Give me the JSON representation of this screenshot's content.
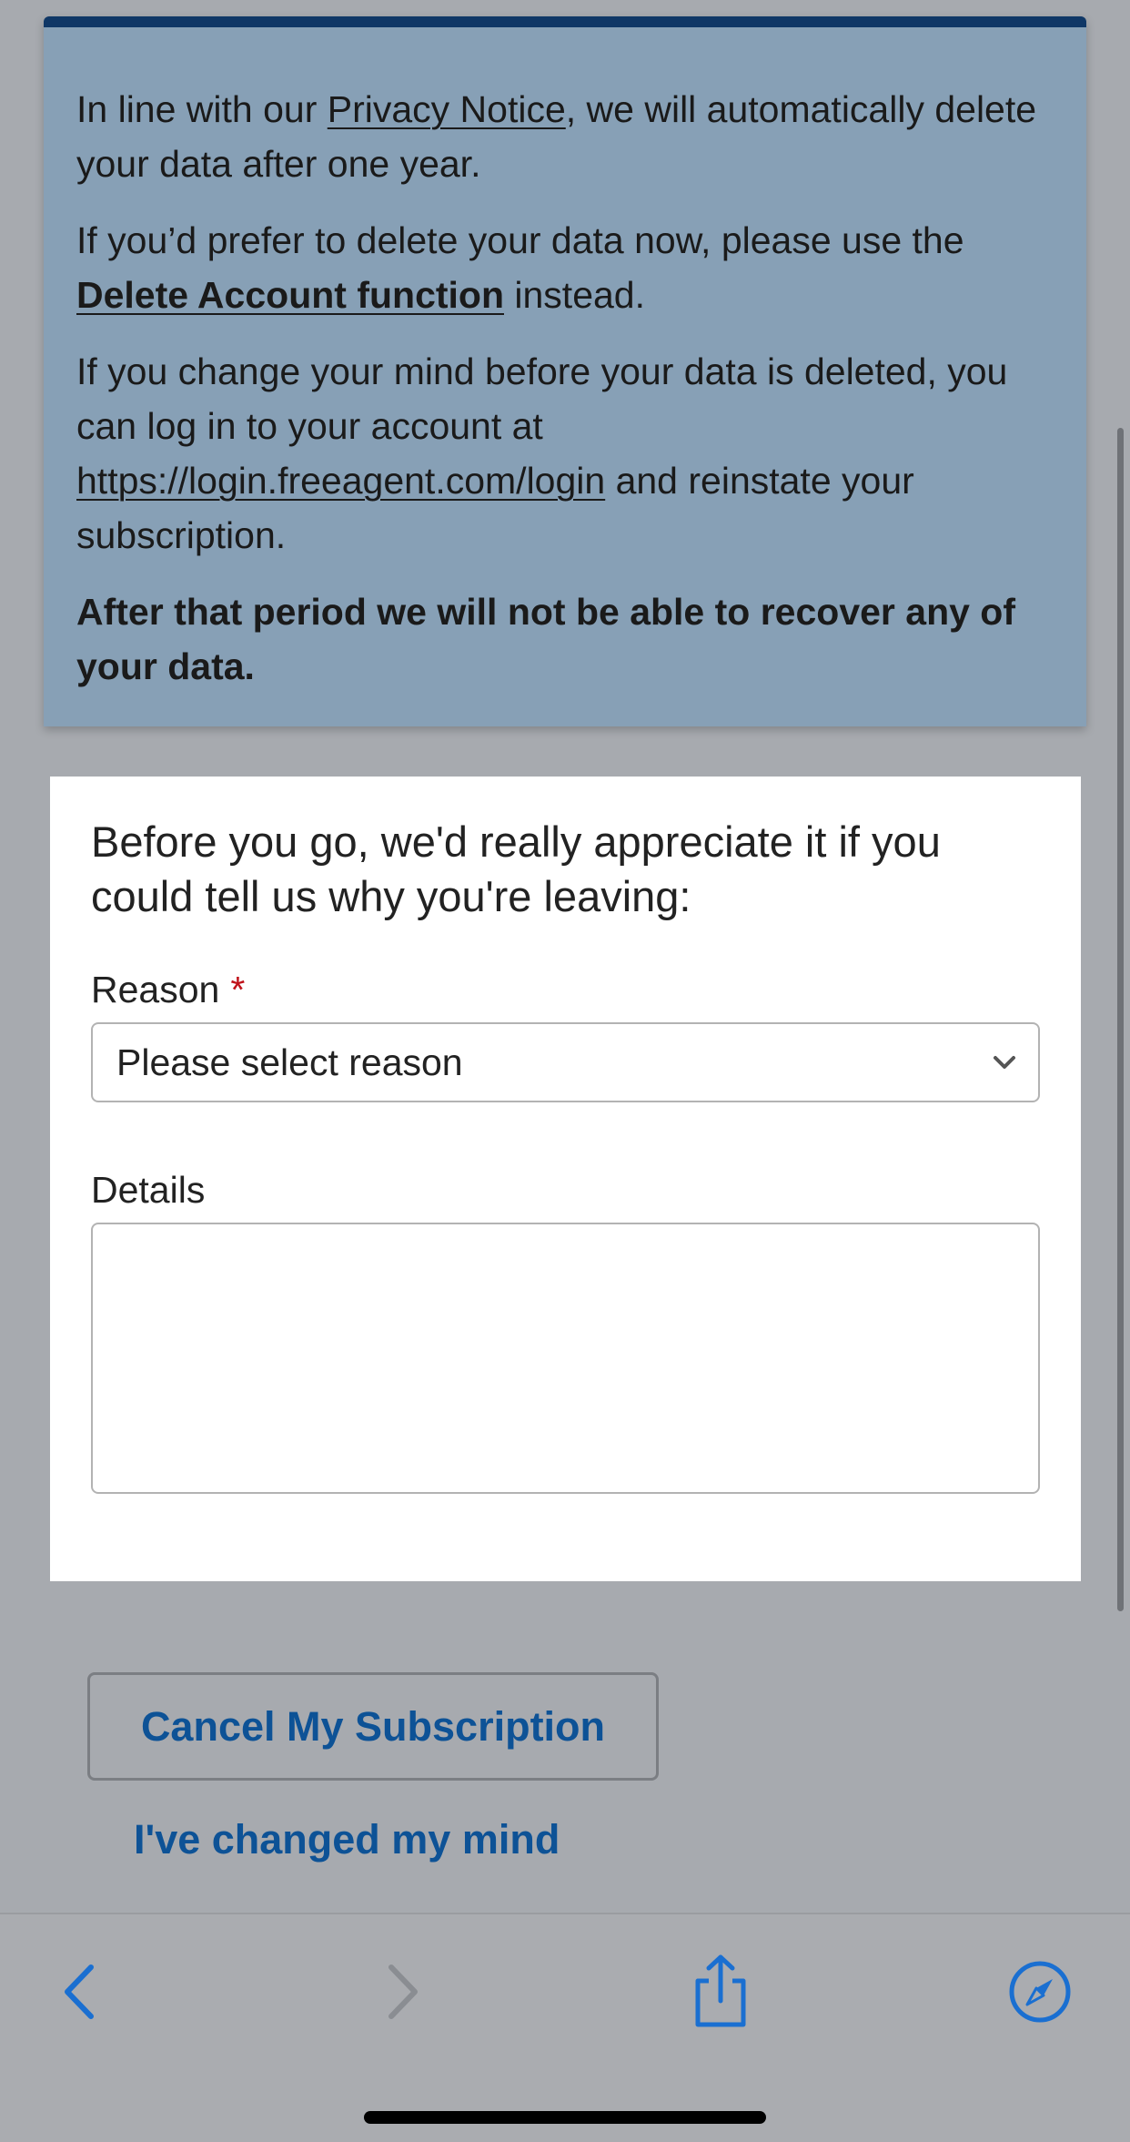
{
  "notice": {
    "p1_before": "In line with our ",
    "p1_link": "Privacy Notice",
    "p1_after": ", we will automatically delete your data after one year.",
    "p2_before": "If you’d prefer to delete your data now, please use the ",
    "p2_link": "Delete Account function",
    "p2_after": " instead.",
    "p3_before": "If you change your mind before your data is deleted, you can log in to your account at ",
    "p3_link": "https://login.freeagent.com/login",
    "p3_after": " and reinstate your subscription.",
    "p4": "After that period we will not be able to recover any of your data."
  },
  "form": {
    "intro": "Before you go, we'd really appreciate it if you could tell us why you're leaving:",
    "reason_label": "Reason",
    "required_marker": "*",
    "reason_selected": "Please select reason",
    "details_label": "Details",
    "details_value": ""
  },
  "actions": {
    "cancel_label": "Cancel My Subscription",
    "changed_mind_label": "I've changed my mind"
  },
  "toolbar": {
    "back_icon": "chevron-left-icon",
    "forward_icon": "chevron-right-icon",
    "share_icon": "share-icon",
    "safari_icon": "compass-icon"
  },
  "colors": {
    "notice_bg": "#87a0b6",
    "notice_border": "#0f3766",
    "link_blue": "#0d5296",
    "required_red": "#c0121a",
    "page_bg": "#a7aaaf",
    "toolbar_icon_active": "#1a6fd1",
    "toolbar_icon_disabled": "#8a8d92"
  }
}
